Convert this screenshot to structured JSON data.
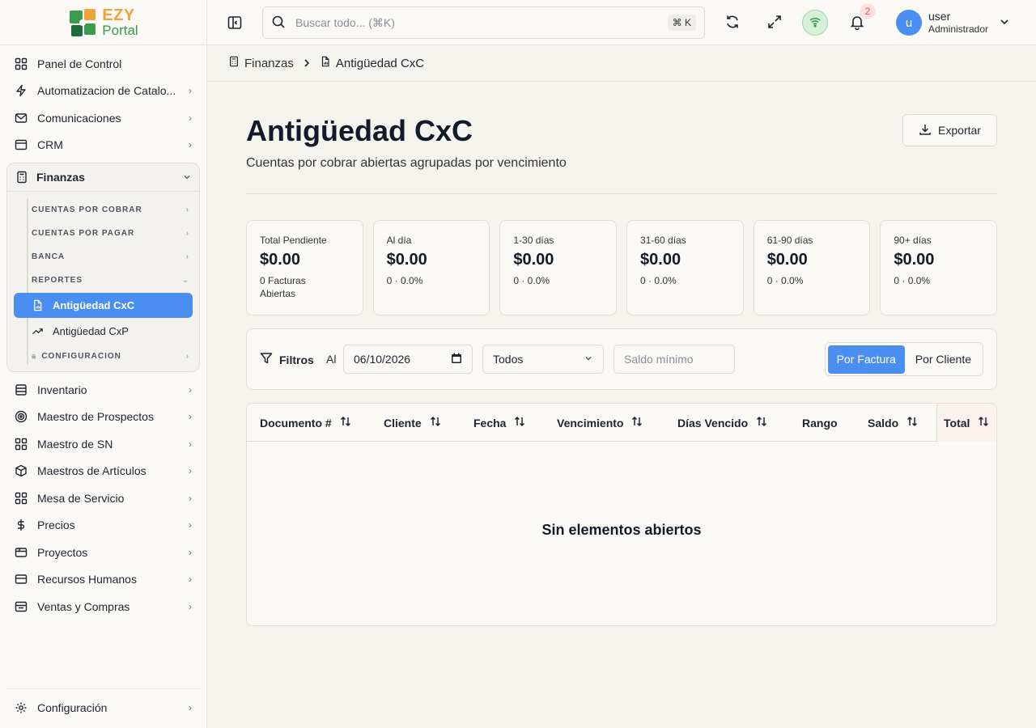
{
  "brand": {
    "line1": "EZY",
    "line2": "Portal"
  },
  "sidebar": {
    "items_top": [
      {
        "label": "Panel de Control",
        "icon": "grid-icon",
        "chevron": false
      },
      {
        "label": "Automatizacion de Catalo...",
        "icon": "bolt-icon",
        "chevron": true
      },
      {
        "label": "Comunicaciones",
        "icon": "mail-icon",
        "chevron": true
      },
      {
        "label": "CRM",
        "icon": "crm-icon",
        "chevron": true
      }
    ],
    "finance": {
      "label": "Finanzas",
      "categories": {
        "cxc": "CUENTAS POR COBRAR",
        "cxp": "CUENTAS POR PAGAR",
        "banca": "BANCA",
        "reportes": "REPORTES",
        "config": "CONFIGURACION"
      },
      "reports": [
        {
          "label": "Antigüedad CxC",
          "active": true
        },
        {
          "label": "Antigüedad CxP",
          "active": false
        }
      ]
    },
    "items_bottom": [
      {
        "label": "Inventario",
        "icon": "database-icon"
      },
      {
        "label": "Maestro de Prospectos",
        "icon": "target-icon"
      },
      {
        "label": "Maestro de SN",
        "icon": "grid-icon"
      },
      {
        "label": "Maestros de Artículos",
        "icon": "box-icon"
      },
      {
        "label": "Mesa de Servicio",
        "icon": "grid-icon"
      },
      {
        "label": "Precios",
        "icon": "dollar-icon"
      },
      {
        "label": "Proyectos",
        "icon": "folder-icon"
      },
      {
        "label": "Recursos Humanos",
        "icon": "users-icon"
      },
      {
        "label": "Ventas y Compras",
        "icon": "cart-icon"
      }
    ],
    "footer": {
      "label": "Configuración"
    }
  },
  "topbar": {
    "search_placeholder": "Buscar todo... (⌘K)",
    "shortcut": "⌘ K",
    "notifications_count": "2",
    "avatar_initial": "u",
    "user_name": "user",
    "user_role": "Administrador"
  },
  "breadcrumb": {
    "parent": "Finanzas",
    "current": "Antigüedad CxC"
  },
  "page": {
    "title": "Antigüedad CxC",
    "subtitle": "Cuentas por cobrar abiertas agrupadas por vencimiento",
    "export_label": "Exportar"
  },
  "kpis": [
    {
      "label": "Total Pendiente",
      "value": "$0.00",
      "foot": "0 Facturas Abiertas"
    },
    {
      "label": "Al día",
      "value": "$0.00",
      "foot": "0 · 0.0%"
    },
    {
      "label": "1-30 días",
      "value": "$0.00",
      "foot": "0 · 0.0%"
    },
    {
      "label": "31-60 días",
      "value": "$0.00",
      "foot": "0 · 0.0%"
    },
    {
      "label": "61-90 días",
      "value": "$0.00",
      "foot": "0 · 0.0%"
    },
    {
      "label": "90+ días",
      "value": "$0.00",
      "foot": "0 · 0.0%"
    }
  ],
  "filters": {
    "label": "Filtros",
    "date_label": "Al",
    "date_value": "06/10/2026",
    "select_value": "Todos",
    "min_balance_placeholder": "Saldo mínimo",
    "toggle": {
      "by_invoice": "Por Factura",
      "by_client": "Por Cliente"
    }
  },
  "table": {
    "columns": [
      "Documento #",
      "Cliente",
      "Fecha",
      "Vencimiento",
      "Días Vencido",
      "Rango",
      "Saldo",
      "Total"
    ],
    "empty_message": "Sin elementos abiertos"
  },
  "colors": {
    "accent": "#4a8ef2",
    "brand_orange": "#f0a33a",
    "brand_green": "#3a9b4e"
  }
}
